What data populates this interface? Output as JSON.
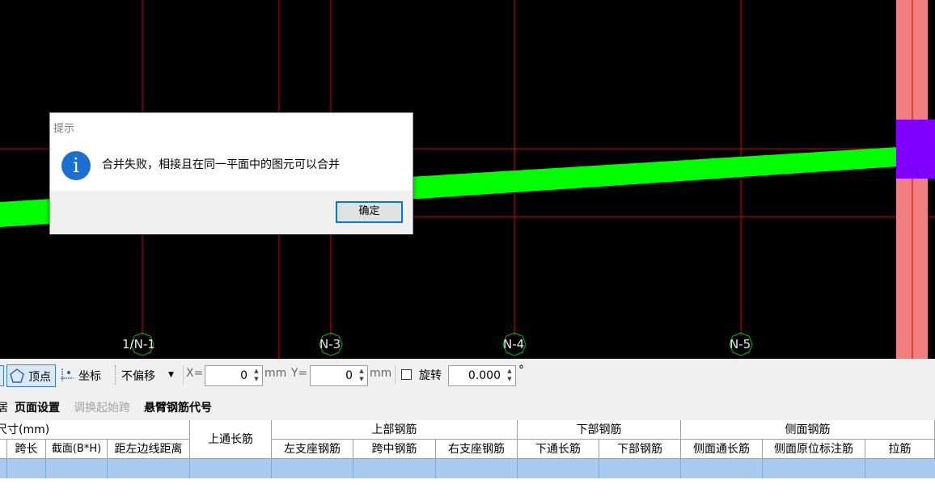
{
  "canvas": {
    "axis_labels": [
      "1/N-1",
      "N-3",
      "N-4",
      "N-5"
    ],
    "colors": {
      "background": "#000000",
      "gridline": "#e00000",
      "beam": "#00ff00",
      "column": "#f08080",
      "column_block": "#8000ff"
    }
  },
  "dialog": {
    "title": "提示",
    "icon": "info-icon",
    "message": "合并失败，相接且在同一平面中的图元可以合并",
    "ok_label": "确定"
  },
  "toolbar": {
    "vertex_label": "顶点",
    "coord_label": "坐标",
    "offset_select": "不偏移",
    "x_label": "X=",
    "x_value": "0",
    "x_unit": "mm",
    "y_label": "Y=",
    "y_value": "0",
    "y_unit": "mm",
    "rotate_label": "旋转",
    "rotate_value": "0.000",
    "degree_symbol": "°"
  },
  "menu": {
    "cut_label": "居",
    "page_setup": "页面设置",
    "swap_start_span": "调换起始跨",
    "cantilever_code": "悬臂钢筋代号"
  },
  "table": {
    "group_headers": {
      "size": "尺寸(mm)",
      "top_through": "上通长筋",
      "top_rebar": "上部钢筋",
      "bottom_rebar": "下部钢筋",
      "side_rebar": "侧面钢筋"
    },
    "sub_headers": [
      "跨长",
      "截面(B*H)",
      "距左边线距离",
      "左支座钢筋",
      "跨中钢筋",
      "右支座钢筋",
      "下通长筋",
      "下部钢筋",
      "侧面通长筋",
      "侧面原位标注筋",
      "拉筋"
    ]
  }
}
